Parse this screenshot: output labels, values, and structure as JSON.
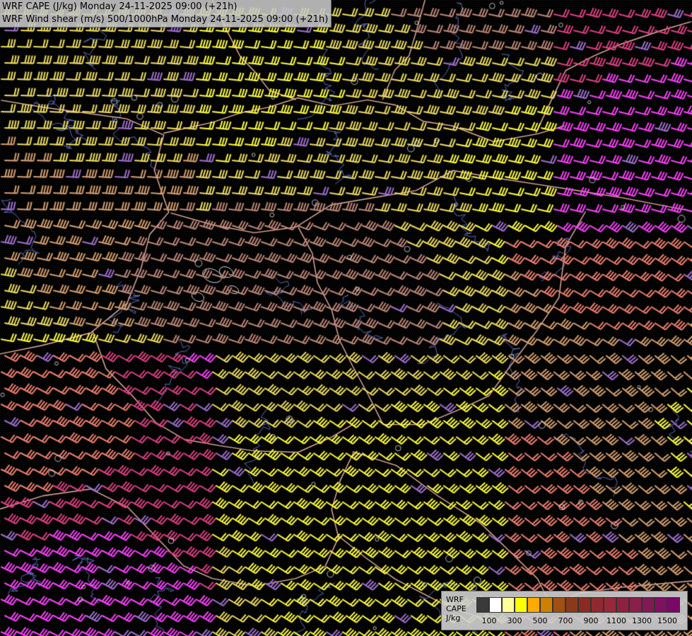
{
  "header": {
    "line1": "WRF CAPE (J/kg) Monday 24-11-2025 09:00 (+21h)",
    "line2": "WRF Wind shear (m/s) 500/1000hPa Monday 24-11-2025 09:00 (+21h)"
  },
  "legend": {
    "title_lines": [
      "WRF",
      "CAPE",
      "J/kg"
    ],
    "swatches": [
      "#3a3a3a",
      "#ffffff",
      "#ffff99",
      "#ffff00",
      "#ffaa00",
      "#d08000",
      "#a05010",
      "#8a3a1a",
      "#8a2a20",
      "#902a30",
      "#98283a",
      "#902040",
      "#88204a",
      "#801a55",
      "#801060",
      "#7a0868"
    ],
    "ticks": [
      "100",
      "300",
      "500",
      "700",
      "900",
      "1100",
      "1300",
      "1500"
    ]
  },
  "colors": {
    "background": "#000000",
    "border_lines": "#e8b0a0",
    "rivers": "#5a6ab8",
    "barb_palette": [
      "#ffff40",
      "#f0e060",
      "#d8a070",
      "#c08878",
      "#f08070",
      "#e04080",
      "#ff40ff",
      "#a070d0"
    ]
  }
}
